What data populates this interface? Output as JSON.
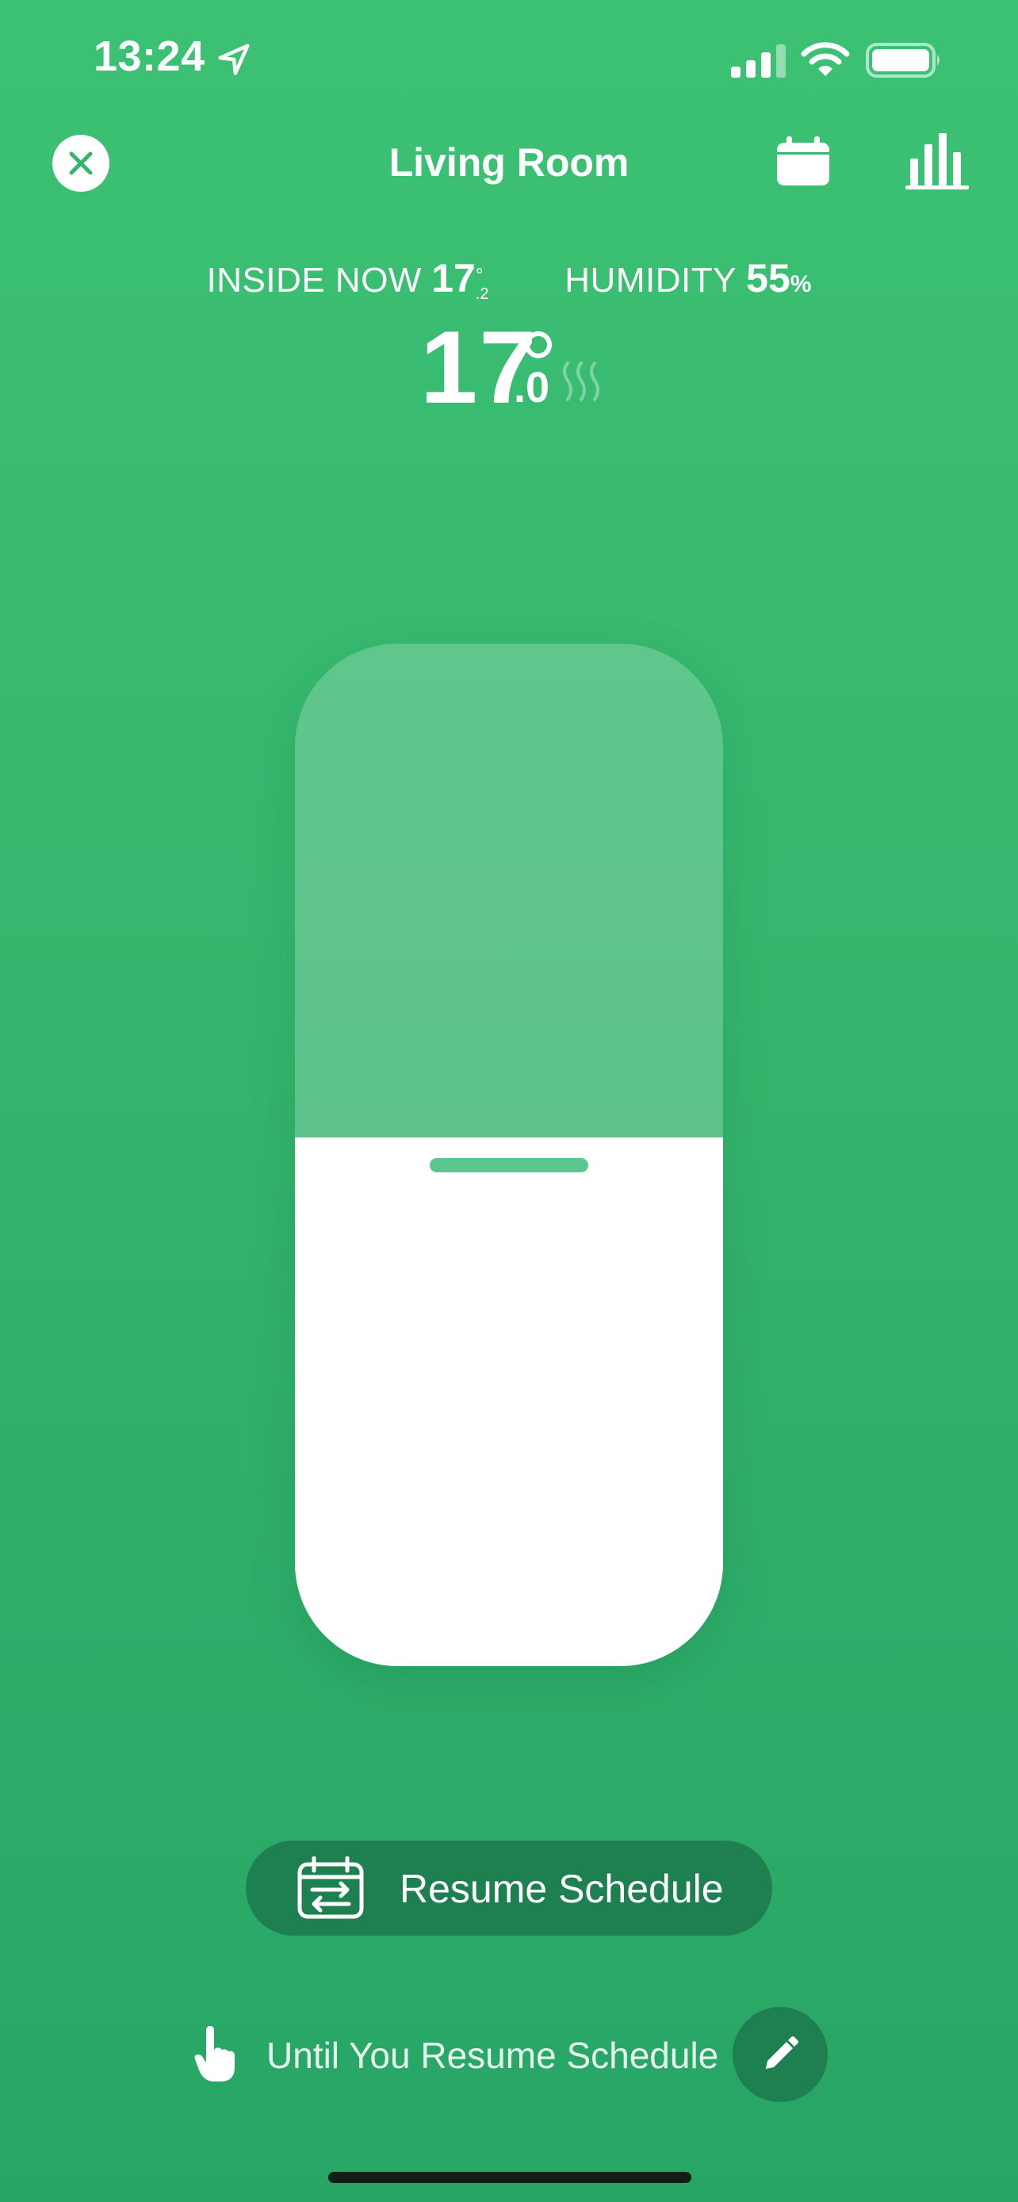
{
  "status_bar": {
    "time": "13:24",
    "icons": [
      "location-arrow-icon",
      "cellular-signal-icon",
      "wifi-icon",
      "battery-icon"
    ]
  },
  "header": {
    "title": "Living Room",
    "icons": [
      "close-icon",
      "calendar-icon",
      "bar-chart-icon"
    ]
  },
  "readings": {
    "inside_label": "INSIDE NOW",
    "inside_whole": "17",
    "inside_decimal": ".2",
    "humidity_label": "HUMIDITY",
    "humidity_value": "55",
    "humidity_unit": "%"
  },
  "setpoint": {
    "whole": "17",
    "decimal": ".0",
    "heating_icon": "heat-waves-icon"
  },
  "slider": {
    "level": 0.517
  },
  "schedule": {
    "resume_label": "Resume Schedule",
    "resume_icon": "calendar-swap-icon",
    "until_text": "Until You Resume Schedule",
    "hand_icon": "hand-pointer-icon",
    "edit_icon": "pencil-icon"
  },
  "colors": {
    "background_top": "#3cc174",
    "background_bottom": "#27a565",
    "button_dark": "#1e8050",
    "handle": "#5bc78e",
    "white": "#ffffff"
  }
}
